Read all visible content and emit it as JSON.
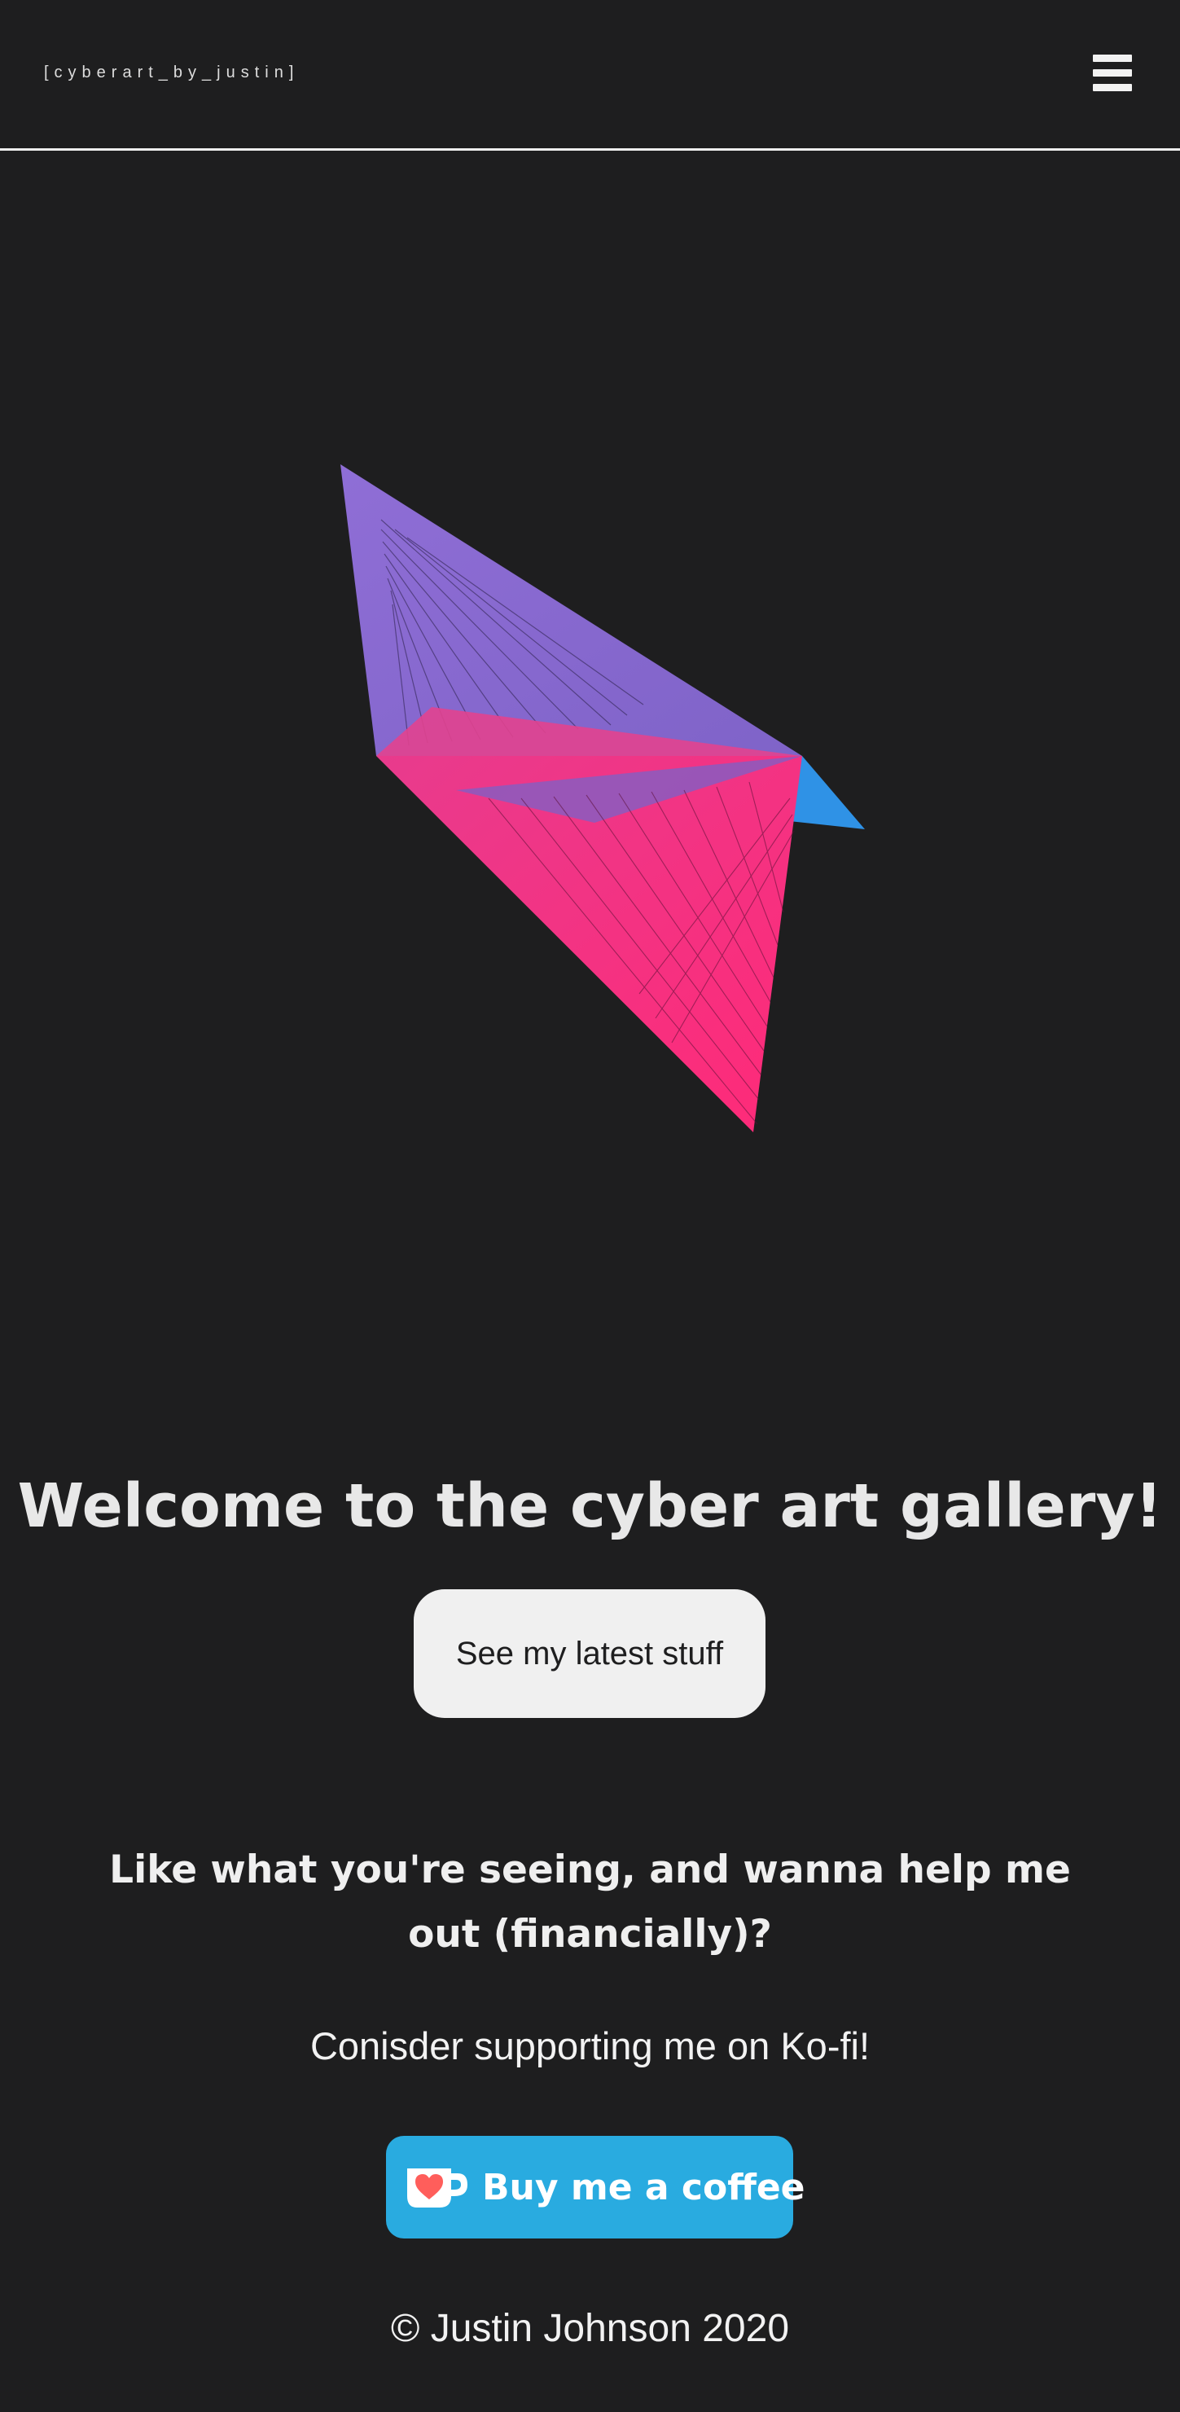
{
  "header": {
    "brand": "[cyberart_by_justin]",
    "menu_icon": "hamburger-menu-icon"
  },
  "hero": {
    "artwork_icon": "geometric-triangle-artwork",
    "colors": {
      "purple": "#8a6bd1",
      "pink": "#ff2f7d",
      "blue": "#2f92e6"
    }
  },
  "main": {
    "welcome": "Welcome to the cyber art gallery!",
    "latest_button": "See my latest stuff"
  },
  "support": {
    "question": "Like what you're seeing, and wanna help me out (financially)?",
    "line": "Conisder supporting me on Ko-fi!",
    "kofi_button": "Buy me a coffee",
    "kofi_icon": "kofi-cup-heart-icon",
    "kofi_color": "#29abe0"
  },
  "footer": {
    "copyright": "© Justin Johnson 2020"
  }
}
